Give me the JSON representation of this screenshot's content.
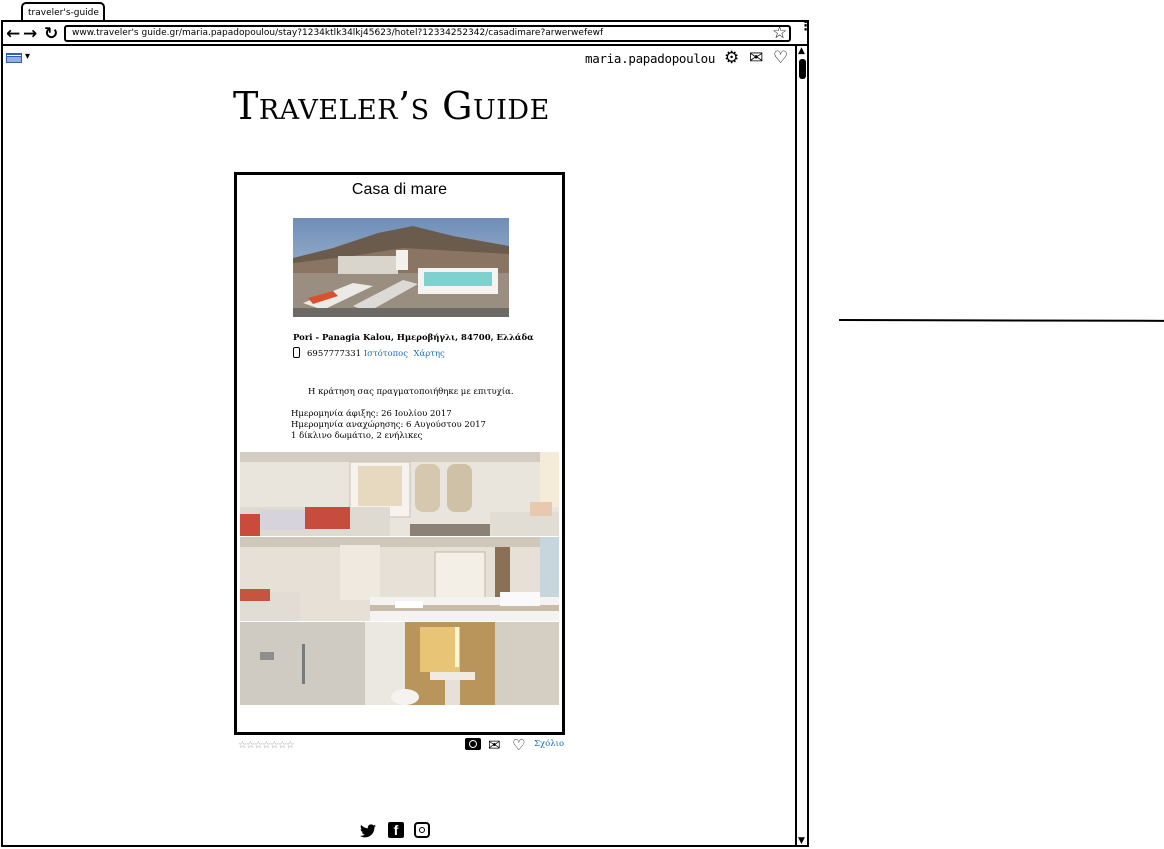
{
  "browser": {
    "tab_title": "traveler's-guide",
    "url": "www.traveler's guide.gr/maria.papadopoulou/stay?1234ktlk34lkj45623/hotel?12334252342/casadimare?arwerwefewf",
    "back_icon": "←",
    "forward_icon": "→",
    "reload_icon": "↻",
    "bookmark_icon": "☆",
    "menu_icon": "⋮",
    "scroll_up_icon": "▲",
    "scroll_down_icon": "▼"
  },
  "header": {
    "language_caret": "▾",
    "username": "maria.papadopoulou",
    "settings_icon": "⚙",
    "mail_icon": "✉",
    "favorites_icon": "♡"
  },
  "logo": "Traveler’s Guide",
  "hotel": {
    "name": "Casa di mare",
    "address": "Pori - Panagia Kalou, Ημεροβήγλι, 84700, Ελλάδα",
    "phone": "6957777331",
    "website_label": "Ιστότοπος",
    "map_label": "Χάρτης"
  },
  "booking": {
    "confirmation": "Η κράτηση σας πραγματοποιήθηκε με επιτυχία.",
    "arrival": "Ημερομηνία άφιξης: 26 Ιουλίου 2017",
    "departure": "Ημερομηνία αναχώρησης: 6 Αυγούστου 2017",
    "room": "1 δίκλινο δωμάτιο, 2 ενήλικες"
  },
  "actions": {
    "rating_stars": "☆☆☆☆☆☆☆",
    "rating_value": 0,
    "rating_max": 7,
    "share_icon": "✉",
    "like_icon": "♡",
    "comment_label": "Σχόλιο"
  },
  "footer": {
    "twitter_icon": "🐦",
    "facebook_icon": "f"
  },
  "colors": {
    "link": "#1e6db3",
    "border": "#000000"
  }
}
